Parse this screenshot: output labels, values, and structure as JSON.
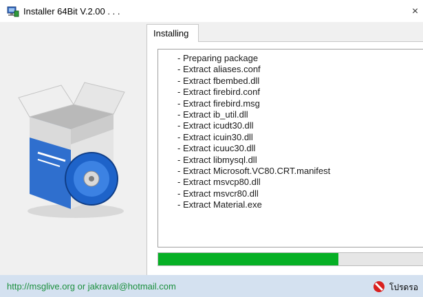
{
  "window": {
    "title": "Installer 64Bit V.2.00 . . .",
    "close_symbol": "×",
    "app_icon": "installer-computer-icon"
  },
  "tabs": [
    {
      "label": "Installing",
      "selected": true
    }
  ],
  "log": {
    "lines": [
      "- Preparing package",
      "- Extract aliases.conf",
      "- Extract fbembed.dll",
      "- Extract firebird.conf",
      "- Extract firebird.msg",
      "- Extract ib_util.dll",
      "- Extract icudt30.dll",
      "- Extract icuin30.dll",
      "- Extract icuuc30.dll",
      "- Extract libmysql.dll",
      "- Extract Microsoft.VC80.CRT.manifest",
      "- Extract msvcp80.dll",
      "- Extract msvcr80.dll",
      "- Extract Material.exe"
    ]
  },
  "progress": {
    "value": 0.68,
    "color": "#06b025"
  },
  "status": {
    "link_text": "http://msglive.org or jakraval@hotmail.com",
    "wait_label": "โปรดรอ",
    "wait_icon": "no-entry-icon"
  },
  "colors": {
    "statusbar": "#d4e1f0",
    "link": "#1a8f3c",
    "client": "#f0f0f0"
  }
}
